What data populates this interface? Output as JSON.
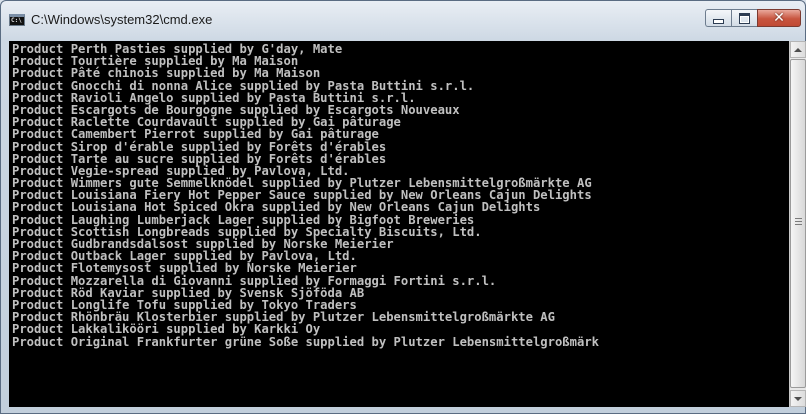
{
  "window": {
    "title": "C:\\Windows\\system32\\cmd.exe",
    "icon": "cmd-icon",
    "icon_text": "C:\\",
    "controls": {
      "minimize": "minimize-icon",
      "maximize": "maximize-icon",
      "close": "close-icon",
      "close_glyph": "✕"
    }
  },
  "colors": {
    "console_background": "#000000",
    "console_text": "#C0C0C0",
    "close_button": "#C8553F"
  },
  "console": {
    "lines": [
      "Product Perth Pasties supplied by G'day, Mate",
      "Product Tourtière supplied by Ma Maison",
      "Product Pâté chinois supplied by Ma Maison",
      "Product Gnocchi di nonna Alice supplied by Pasta Buttini s.r.l.",
      "Product Ravioli Angelo supplied by Pasta Buttini s.r.l.",
      "Product Escargots de Bourgogne supplied by Escargots Nouveaux",
      "Product Raclette Courdavault supplied by Gai pâturage",
      "Product Camembert Pierrot supplied by Gai pâturage",
      "Product Sirop d'érable supplied by Forêts d'érables",
      "Product Tarte au sucre supplied by Forêts d'érables",
      "Product Vegie-spread supplied by Pavlova, Ltd.",
      "Product Wimmers gute Semmelknödel supplied by Plutzer Lebensmittelgroßmärkte AG",
      "Product Louisiana Fiery Hot Pepper Sauce supplied by New Orleans Cajun Delights",
      "Product Louisiana Hot Spiced Okra supplied by New Orleans Cajun Delights",
      "Product Laughing Lumberjack Lager supplied by Bigfoot Breweries",
      "Product Scottish Longbreads supplied by Specialty Biscuits, Ltd.",
      "Product Gudbrandsdalsost supplied by Norske Meierier",
      "Product Outback Lager supplied by Pavlova, Ltd.",
      "Product Flotemysost supplied by Norske Meierier",
      "Product Mozzarella di Giovanni supplied by Formaggi Fortini s.r.l.",
      "Product Röd Kaviar supplied by Svensk Sjöföda AB",
      "Product Longlife Tofu supplied by Tokyo Traders",
      "Product Rhönbräu Klosterbier supplied by Plutzer Lebensmittelgroßmärkte AG",
      "Product Lakkalikööri supplied by Karkki Oy",
      "Product Original Frankfurter grüne Soße supplied by Plutzer Lebensmittelgroßmärk"
    ]
  },
  "scrollbar": {
    "up_icon": "scroll-up-arrow-icon",
    "down_icon": "scroll-down-arrow-icon",
    "position": 1.0
  }
}
